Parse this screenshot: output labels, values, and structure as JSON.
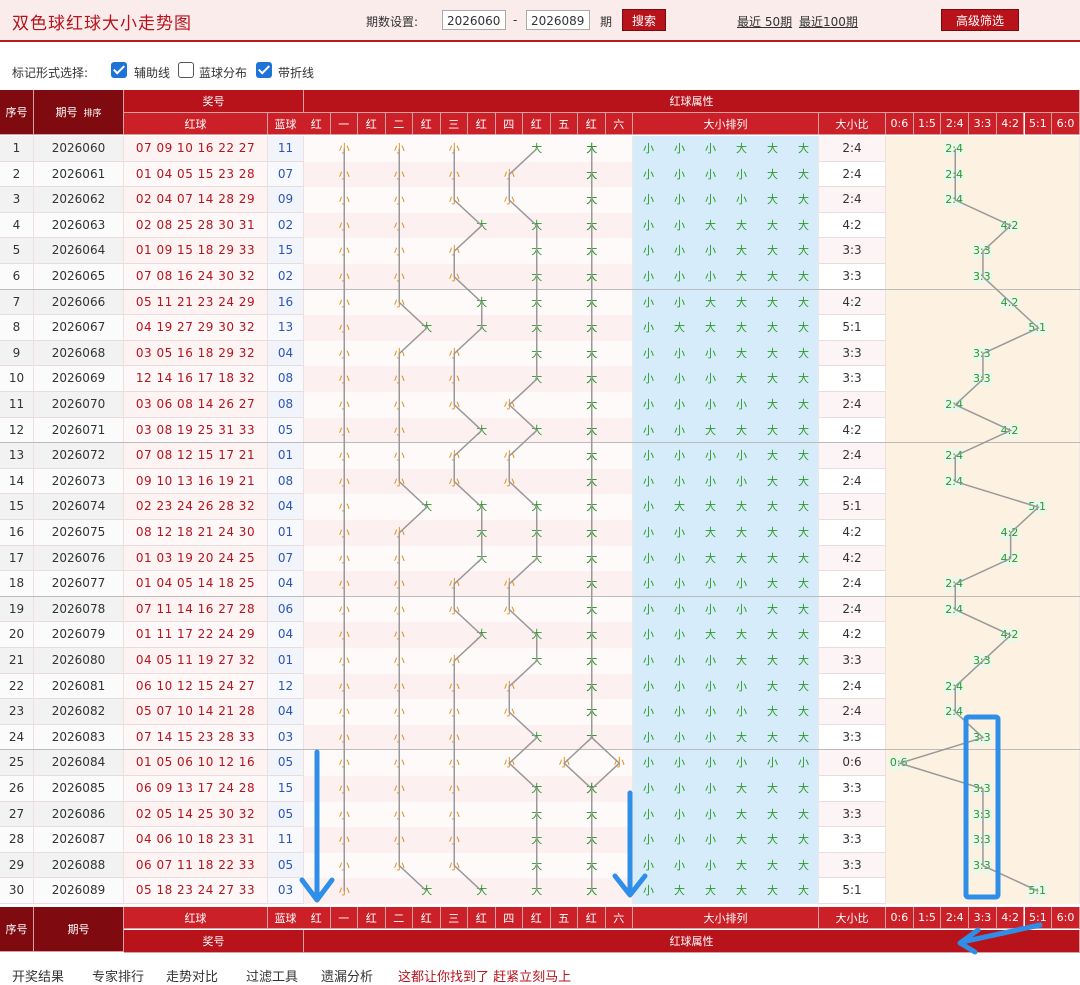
{
  "header": {
    "title": "双色球红球大小走势图",
    "period_label": "期数设置:",
    "from": "2026060",
    "to": "2026089",
    "unit": "期",
    "search_label": "搜索",
    "recent50": "最近 50期",
    "recent100": "最近100期",
    "advanced_label": "高级筛选"
  },
  "marks": {
    "label": "标记形式选择:",
    "opt1": "辅助线",
    "opt2": "蓝球分布",
    "opt3": "带折线",
    "opt1_checked": true,
    "opt2_checked": false,
    "opt3_checked": true
  },
  "thead": {
    "idx": "序号",
    "issue": "期号",
    "sort": "排序",
    "prize": "奖号",
    "red": "红球",
    "blue": "蓝球",
    "attr": "红球属性",
    "positions": [
      "红",
      "一",
      "红",
      "二",
      "红",
      "三",
      "红",
      "四",
      "红",
      "五",
      "红",
      "六"
    ],
    "arrange": "大小排列",
    "ratio": "大小比",
    "ratios": [
      "0:6",
      "1:5",
      "2:4",
      "3:3",
      "4:2",
      "5:1",
      "6:0"
    ]
  },
  "rows": [
    {
      "idx": "1",
      "issue": "2026060",
      "red": "07 09 10 16 22 27",
      "blue": "11",
      "sb": "SSSBBB",
      "ratio": "2:4"
    },
    {
      "idx": "2",
      "issue": "2026061",
      "red": "01 04 05 15 23 28",
      "blue": "07",
      "sb": "SSSSBB",
      "ratio": "2:4"
    },
    {
      "idx": "3",
      "issue": "2026062",
      "red": "02 04 07 14 28 29",
      "blue": "09",
      "sb": "SSSSBB",
      "ratio": "2:4"
    },
    {
      "idx": "4",
      "issue": "2026063",
      "red": "02 08 25 28 30 31",
      "blue": "02",
      "sb": "SSBBBB",
      "ratio": "4:2"
    },
    {
      "idx": "5",
      "issue": "2026064",
      "red": "01 09 15 18 29 33",
      "blue": "15",
      "sb": "SSSBBB",
      "ratio": "3:3"
    },
    {
      "idx": "6",
      "issue": "2026065",
      "red": "07 08 16 24 30 32",
      "blue": "02",
      "sb": "SSSBBB",
      "ratio": "3:3"
    },
    {
      "idx": "7",
      "issue": "2026066",
      "red": "05 11 21 23 24 29",
      "blue": "16",
      "sb": "SSBBBB",
      "ratio": "4:2"
    },
    {
      "idx": "8",
      "issue": "2026067",
      "red": "04 19 27 29 30 32",
      "blue": "13",
      "sb": "SBBBBB",
      "ratio": "5:1"
    },
    {
      "idx": "9",
      "issue": "2026068",
      "red": "03 05 16 18 29 32",
      "blue": "04",
      "sb": "SSSBBB",
      "ratio": "3:3"
    },
    {
      "idx": "10",
      "issue": "2026069",
      "red": "12 14 16 17 18 32",
      "blue": "08",
      "sb": "SSSBBB",
      "ratio": "3:3"
    },
    {
      "idx": "11",
      "issue": "2026070",
      "red": "03 06 08 14 26 27",
      "blue": "08",
      "sb": "SSSSBB",
      "ratio": "2:4"
    },
    {
      "idx": "12",
      "issue": "2026071",
      "red": "03 08 19 25 31 33",
      "blue": "05",
      "sb": "SSBBBB",
      "ratio": "4:2"
    },
    {
      "idx": "13",
      "issue": "2026072",
      "red": "07 08 12 15 17 21",
      "blue": "01",
      "sb": "SSSSBB",
      "ratio": "2:4"
    },
    {
      "idx": "14",
      "issue": "2026073",
      "red": "09 10 13 16 19 21",
      "blue": "08",
      "sb": "SSSSBB",
      "ratio": "2:4"
    },
    {
      "idx": "15",
      "issue": "2026074",
      "red": "02 23 24 26 28 32",
      "blue": "04",
      "sb": "SBBBBB",
      "ratio": "5:1"
    },
    {
      "idx": "16",
      "issue": "2026075",
      "red": "08 12 18 21 24 30",
      "blue": "01",
      "sb": "SSBBBB",
      "ratio": "4:2"
    },
    {
      "idx": "17",
      "issue": "2026076",
      "red": "01 03 19 20 24 25",
      "blue": "07",
      "sb": "SSBBBB",
      "ratio": "4:2"
    },
    {
      "idx": "18",
      "issue": "2026077",
      "red": "01 04 05 14 18 25",
      "blue": "04",
      "sb": "SSSSBB",
      "ratio": "2:4"
    },
    {
      "idx": "19",
      "issue": "2026078",
      "red": "07 11 14 16 27 28",
      "blue": "06",
      "sb": "SSSSBB",
      "ratio": "2:4"
    },
    {
      "idx": "20",
      "issue": "2026079",
      "red": "01 11 17 22 24 29",
      "blue": "04",
      "sb": "SSBBBB",
      "ratio": "4:2"
    },
    {
      "idx": "21",
      "issue": "2026080",
      "red": "04 05 11 19 27 32",
      "blue": "01",
      "sb": "SSSBBB",
      "ratio": "3:3"
    },
    {
      "idx": "22",
      "issue": "2026081",
      "red": "06 10 12 15 24 27",
      "blue": "12",
      "sb": "SSSSBB",
      "ratio": "2:4"
    },
    {
      "idx": "23",
      "issue": "2026082",
      "red": "05 07 10 14 21 28",
      "blue": "04",
      "sb": "SSSSBB",
      "ratio": "2:4"
    },
    {
      "idx": "24",
      "issue": "2026083",
      "red": "07 14 15 23 28 33",
      "blue": "03",
      "sb": "SSSBBB",
      "ratio": "3:3"
    },
    {
      "idx": "25",
      "issue": "2026084",
      "red": "01 05 06 10 12 16",
      "blue": "05",
      "sb": "SSSSSS",
      "ratio": "0:6"
    },
    {
      "idx": "26",
      "issue": "2026085",
      "red": "06 09 13 17 24 28",
      "blue": "15",
      "sb": "SSSBBB",
      "ratio": "3:3"
    },
    {
      "idx": "27",
      "issue": "2026086",
      "red": "02 05 14 25 30 32",
      "blue": "05",
      "sb": "SSSBBB",
      "ratio": "3:3"
    },
    {
      "idx": "28",
      "issue": "2026087",
      "red": "04 06 10 18 23 31",
      "blue": "11",
      "sb": "SSSBBB",
      "ratio": "3:3"
    },
    {
      "idx": "29",
      "issue": "2026088",
      "red": "06 07 11 18 22 33",
      "blue": "05",
      "sb": "SSSBBB",
      "ratio": "3:3"
    },
    {
      "idx": "30",
      "issue": "2026089",
      "red": "05 18 23 24 27 33",
      "blue": "03",
      "sb": "SBBBBB",
      "ratio": "5:1"
    }
  ],
  "big_label": "大",
  "small_label": "小",
  "footer": {
    "items": [
      "开奖结果",
      "专家排行",
      "走势对比",
      "过滤工具",
      "遗漏分析"
    ],
    "note": "这都让你找到了 赶紧立刻马上"
  },
  "colors": {
    "brand": "#b8121b",
    "small": "#e08a12",
    "big": "#2b9a2b",
    "blue_ball": "#2b55b5",
    "annotation": "#2f8fe8"
  }
}
